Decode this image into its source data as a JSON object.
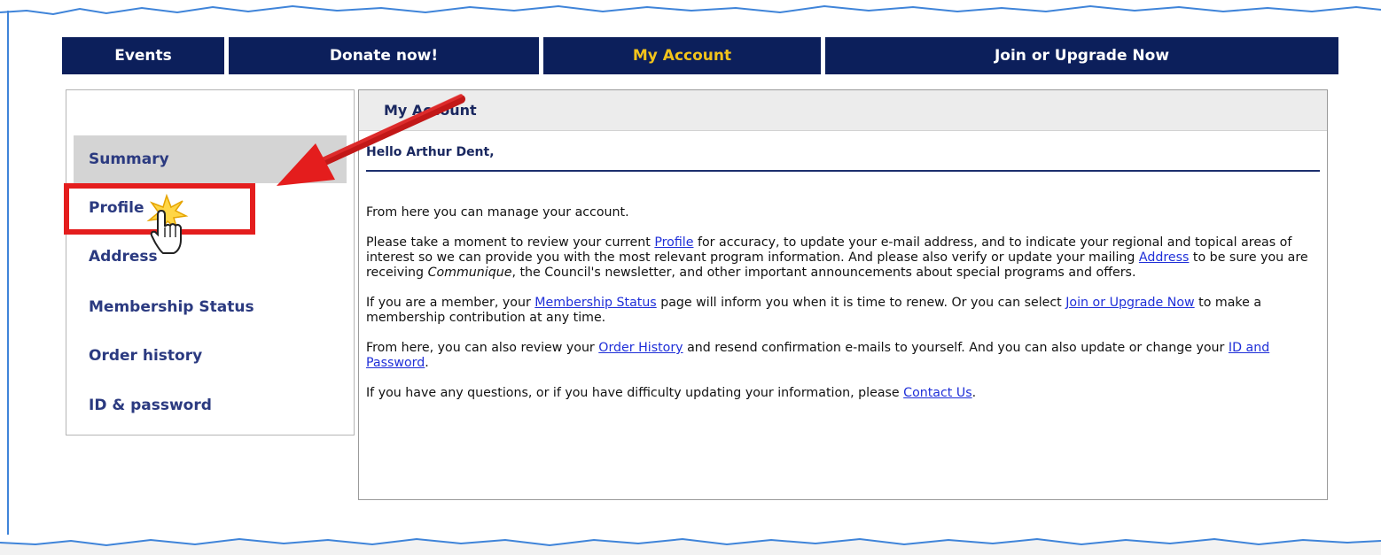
{
  "nav": {
    "tabs": [
      {
        "label": "Events"
      },
      {
        "label": "Donate now!"
      },
      {
        "label": "My Account",
        "active": true
      },
      {
        "label": "Join or Upgrade Now"
      }
    ]
  },
  "sidebar": {
    "items": [
      {
        "label": "Summary",
        "active": true
      },
      {
        "label": "Profile"
      },
      {
        "label": "Address"
      },
      {
        "label": "Membership Status"
      },
      {
        "label": "Order history"
      },
      {
        "label": "ID & password"
      }
    ]
  },
  "main": {
    "title": "My Account",
    "greeting": "Hello Arthur Dent,",
    "p1": "From here you can manage your account.",
    "p2": {
      "t1": "Please take a moment to review your current ",
      "link1": "Profile",
      "t2": " for accuracy, to update your e-mail address, and to indicate your regional and topical areas of interest so we can provide you with the most relevant program information. And please also verify or update your mailing ",
      "link2": "Address",
      "t3": " to be sure you are receiving ",
      "em": "Communique",
      "t4": ", the Council's newsletter, and other important announcements about special programs and offers."
    },
    "p3": {
      "t1": "If you are a member, your ",
      "link1": "Membership Status",
      "t2": " page will inform you when it is time to renew. Or you can select ",
      "link2": "Join or Upgrade Now",
      "t3": " to make a membership contribution at any time."
    },
    "p4": {
      "t1": "From here, you can also review your ",
      "link1": "Order History",
      "t2": " and resend confirmation e-mails to yourself. And you can also update or change your ",
      "link2": "ID and Password",
      "t3": "."
    },
    "p5": {
      "t1": "If you have any questions, or if you have difficulty updating your information, please ",
      "link1": "Contact Us",
      "t2": "."
    }
  },
  "annotation": {
    "color": "#e41d1d",
    "arrow": "arrow-pointing-to-profile",
    "cursor": "hand-pointer-icon"
  }
}
